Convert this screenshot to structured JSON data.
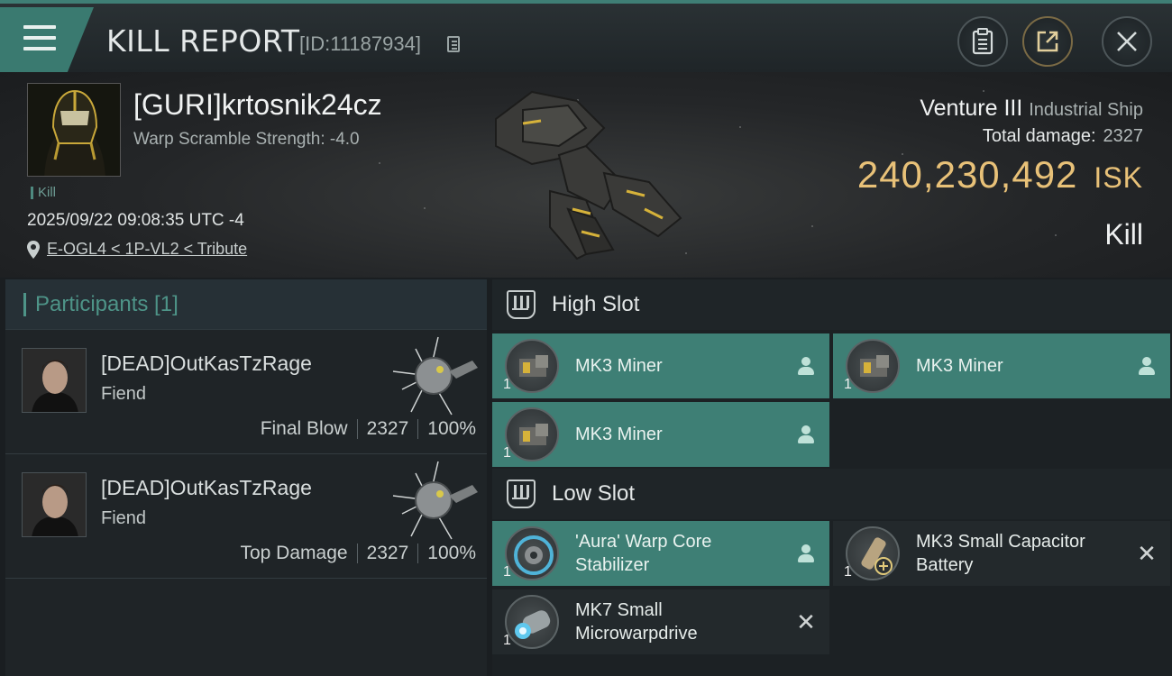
{
  "header": {
    "title": "KILL REPORT",
    "id_label": "[ID:11187934]"
  },
  "victim": {
    "name": "[GURI]krtosnik24cz",
    "warp_scramble": "Warp Scramble Strength: -4.0",
    "tag": "Kill",
    "timestamp": "2025/09/22 09:08:35 UTC -4",
    "location": "E-OGL4 < 1P-VL2 < Tribute",
    "ship_name": "Venture III",
    "ship_class": "Industrial Ship",
    "total_damage_label": "Total damage:",
    "total_damage_value": "2327",
    "isk_value": "240,230,492",
    "isk_unit": "ISK",
    "result": "Kill"
  },
  "participants": {
    "header": "Participants [1]",
    "rows": [
      {
        "name": "[DEAD]OutKasTzRage",
        "ship": "Fiend",
        "role": "Final Blow",
        "damage": "2327",
        "percent": "100%"
      },
      {
        "name": "[DEAD]OutKasTzRage",
        "ship": "Fiend",
        "role": "Top Damage",
        "damage": "2327",
        "percent": "100%"
      }
    ]
  },
  "fitting": {
    "high_slot_title": "High Slot",
    "low_slot_title": "Low Slot",
    "high_slot": [
      {
        "name": "MK3 Miner",
        "qty": "1",
        "status": "pilot-icon"
      },
      {
        "name": "MK3 Miner",
        "qty": "1",
        "status": "pilot-icon"
      },
      {
        "name": "MK3 Miner",
        "qty": "1",
        "status": "pilot-icon"
      }
    ],
    "low_slot": [
      {
        "name": "'Aura' Warp Core Stabilizer",
        "qty": "1",
        "status": "pilot-icon"
      },
      {
        "name": "MK3 Small Capacitor Battery",
        "qty": "1",
        "status": "close-icon"
      },
      {
        "name": "MK7 Small Microwarpdrive",
        "qty": "1",
        "status": "close-icon"
      }
    ]
  },
  "colors": {
    "accent_teal": "#3e7f75",
    "isk_gold": "#e8c178"
  }
}
